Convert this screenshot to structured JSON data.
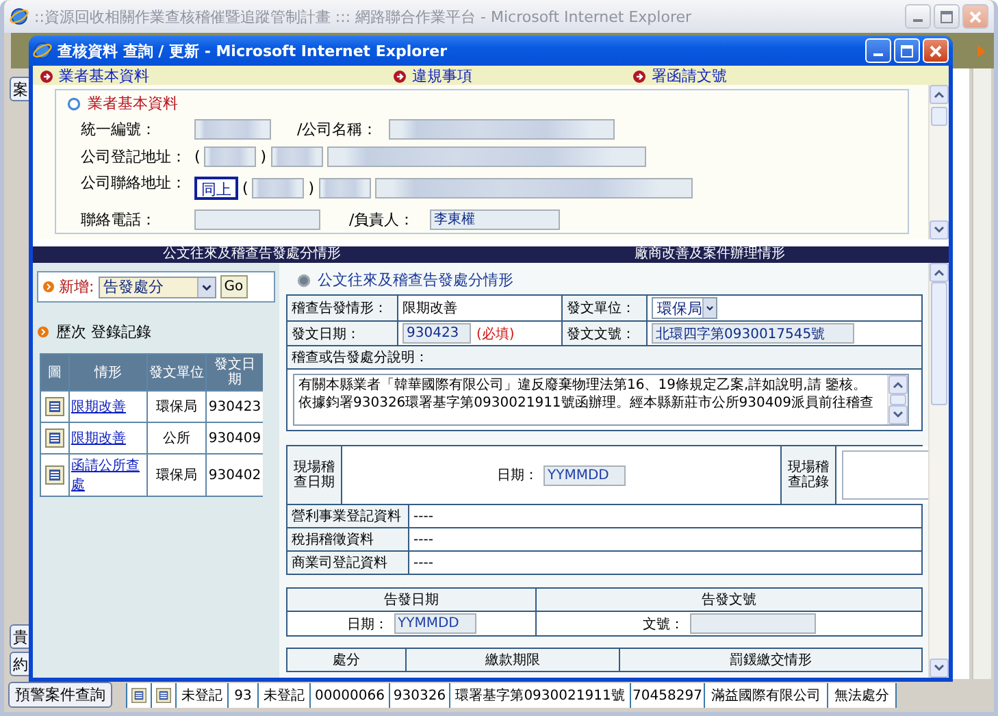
{
  "window": {
    "title": "::資源回收相關作業查核稽催暨追蹤管制計畫 ::: 網路聯合作業平台 - Microsoft Internet Explorer"
  },
  "background": {
    "top_tab": "案",
    "side_tabs": [
      "貴",
      "約"
    ],
    "query_button": "預警案件查詢",
    "table_row": [
      "未登記",
      "93",
      "未登記",
      "00000066",
      "930326",
      "環署基字第0930021911號",
      "70458297",
      "滿益國際有限公司",
      "無法處分"
    ]
  },
  "popup": {
    "title": "查核資料 查詢 / 更新 - Microsoft Internet Explorer",
    "nav": [
      "業者基本資料",
      "違規事項",
      "署函請文號"
    ],
    "company": {
      "heading": "業者基本資料",
      "tax_id_label": "統一編號：",
      "name_label": "/公司名稱：",
      "reg_address": {
        "label": "公司登記地址：",
        "brackets": [
          "(",
          ")"
        ]
      },
      "contact_address": {
        "label": "公司聯絡地址：",
        "same_button": "同上",
        "brackets": [
          "(",
          ")"
        ]
      },
      "phone_label": "聯絡電話：",
      "owner_label": "/負責人：",
      "owner_value": "李東權"
    },
    "section_bar": [
      "公文往來及稽查告發處分情形",
      "廠商改善及案件辦理情形"
    ],
    "add": {
      "label": "新增:",
      "select": "告發處分",
      "go": "Go"
    },
    "history": {
      "heading": "歷次 登錄記錄",
      "columns": [
        "圖",
        "情形",
        "發文單位",
        "發文日期"
      ],
      "rows": [
        {
          "situation": "限期改善",
          "unit": "環保局",
          "date": "930423"
        },
        {
          "situation": "限期改善",
          "unit": "公所",
          "date": "930409"
        },
        {
          "situation": "函請公所查處",
          "unit": "環保局",
          "date": "930402"
        }
      ]
    },
    "detail": {
      "heading": "公文往來及稽查告發處分情形",
      "situation_label": "稽查告發情形：",
      "situation": "限期改善",
      "unit_label": "發文單位：",
      "unit": "環保局",
      "date_label": "發文日期：",
      "date": "930423",
      "required": "(必填)",
      "doc_label": "發文文號：",
      "doc": "北環四字第0930017545號",
      "desc_label": "稽查或告發處分說明：",
      "desc": [
        "有關本縣業者「韓華國際有限公司」違反廢棄物理法第16、19條規定乙案,詳如說明,請 鑒核。",
        "依據鈞署930326環署基字第0930021911號函辦理。經本縣新莊市公所930409派員前往稽查"
      ],
      "site_date_label": "現場稽查日期",
      "site_day_label": "日期：",
      "site_date_placeholder": "YYMMDD",
      "site_record_label": "現場稽查記錄",
      "registries": [
        {
          "name": "營利事業登記資料",
          "status": "----"
        },
        {
          "name": "稅捐稽徵資料",
          "status": "----"
        },
        {
          "name": "商業司登記資料",
          "status": "----"
        }
      ],
      "notice_columns": [
        "告發日期",
        "告發文號"
      ],
      "notice_date_label": "日期：",
      "notice_date_placeholder": "YYMMDD",
      "notice_no_label": "文號：",
      "penalty_columns": [
        "處分",
        "繳款期限",
        "罰鍰繳交情形"
      ]
    }
  }
}
